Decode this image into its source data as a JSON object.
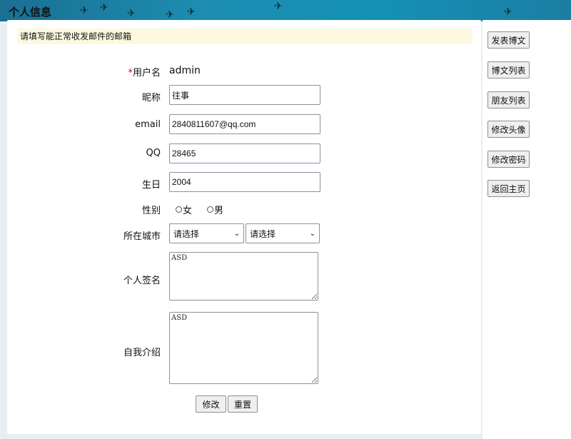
{
  "header": {
    "title": "个人信息"
  },
  "notice": "请填写能正常收发邮件的邮箱",
  "form": {
    "username": {
      "label": "用户名",
      "required_mark": "*",
      "value": "admin"
    },
    "nickname": {
      "label": "昵称",
      "value": "往事"
    },
    "email": {
      "label": "email",
      "value": "2840811607@qq.com"
    },
    "qq": {
      "label": "QQ",
      "value": "28465"
    },
    "birthday": {
      "label": "生日",
      "value": "2004"
    },
    "gender": {
      "label": "性别",
      "options": [
        "女",
        "男"
      ]
    },
    "city": {
      "label": "所在城市",
      "province_selected": "请选择",
      "city_selected": "请选择"
    },
    "signature": {
      "label": "个人签名",
      "value": "ASD"
    },
    "intro": {
      "label": "自我介绍",
      "value": "ASD"
    },
    "submit_label": "修改",
    "reset_label": "重置"
  },
  "sidebar": {
    "items": [
      {
        "label": "发表博文"
      },
      {
        "label": "博文列表"
      },
      {
        "label": "朋友列表"
      },
      {
        "label": "修改头像"
      },
      {
        "label": "修改密码"
      },
      {
        "label": "返回主页"
      }
    ]
  },
  "colors": {
    "banner": "#1c8db0",
    "notice_bg": "#fdf9e0",
    "required": "#d0021b"
  }
}
